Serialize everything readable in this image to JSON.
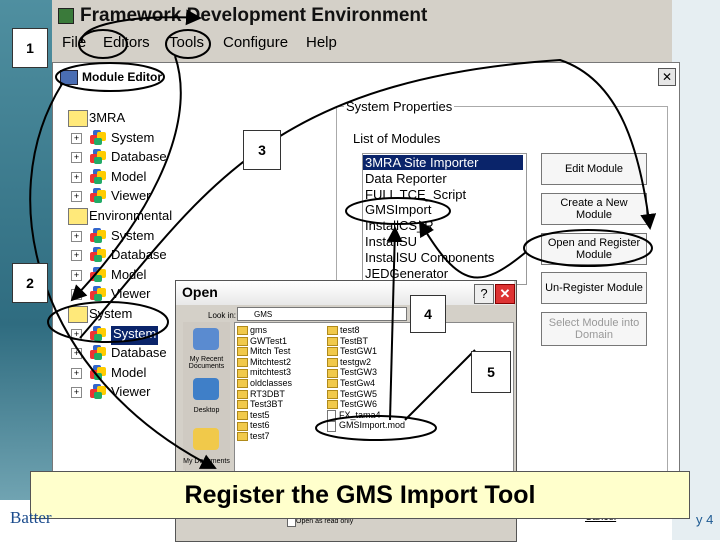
{
  "app": {
    "title": "Framework Development Environment",
    "menu": [
      "File",
      "Editors",
      "Tools",
      "Configure",
      "Help"
    ]
  },
  "module_editor": {
    "title": "Module Editor",
    "close": "✕",
    "tree": [
      {
        "label": "3MRA",
        "kind": "root"
      },
      {
        "label": "System",
        "kind": "child"
      },
      {
        "label": "Database",
        "kind": "child"
      },
      {
        "label": "Model",
        "kind": "child"
      },
      {
        "label": "Viewer",
        "kind": "child"
      },
      {
        "label": "Environmental",
        "kind": "root"
      },
      {
        "label": "System",
        "kind": "child"
      },
      {
        "label": "Database",
        "kind": "child"
      },
      {
        "label": "Model",
        "kind": "child"
      },
      {
        "label": "Viewer",
        "kind": "child"
      },
      {
        "label": "System",
        "kind": "root"
      },
      {
        "label": "System",
        "kind": "child",
        "selected": true
      },
      {
        "label": "Database",
        "kind": "child"
      },
      {
        "label": "Model",
        "kind": "child"
      },
      {
        "label": "Viewer",
        "kind": "child"
      }
    ],
    "system_properties_label": "System Properties",
    "list_of_modules_label": "List of Modules",
    "modules": [
      "3MRA Site Importer",
      "Data Reporter",
      "FULL TCE_Script",
      "GMSImport",
      "InstallCS_R",
      "InstallSU",
      "InstallSU Components",
      "JEDGenerator"
    ],
    "buttons": {
      "edit": "Edit Module",
      "create": "Create a New Module",
      "open_register": "Open and Register Module",
      "unregister": "Un-Register Module",
      "select_into_domain": "Select Module into Domain"
    }
  },
  "open_dialog": {
    "title": "Open",
    "help": "?",
    "close": "✕",
    "look_in_label": "Look in:",
    "look_in_value": "GMS",
    "places": [
      "My Recent Documents",
      "Desktop",
      "My Documents"
    ],
    "files_col1": [
      "gms",
      "GWTest1",
      "Mitch Test",
      "Mitchtest2",
      "mitchtest3",
      "oldclasses",
      "RT3DBT",
      "Test3BT",
      "test5",
      "test6",
      "test7"
    ],
    "files_col2": [
      "test8",
      "TestBT",
      "TestGW1",
      "testgw2",
      "TestGW3",
      "TestGw4",
      "TestGW5",
      "TestGW6",
      "FX_tama4",
      "GMSImport.mod"
    ],
    "open_readonly": "Open as read only",
    "cancel": "Cancel"
  },
  "caption": "Register the GMS Import Tool",
  "bottom_left_text": "Batter",
  "right_corner_text": "y 4",
  "steps": [
    "1",
    "2",
    "3",
    "4",
    "5"
  ]
}
